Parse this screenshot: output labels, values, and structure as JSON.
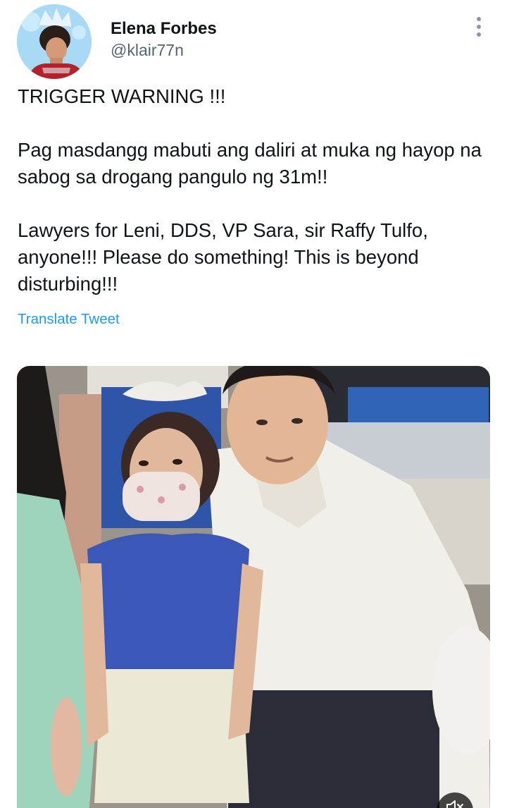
{
  "author": {
    "display_name": "Elena Forbes",
    "handle": "@klair77n",
    "avatar_icon": "avatar-illustration"
  },
  "tweet": {
    "paragraphs": [
      "TRIGGER WARNING !!!",
      "Pag masdangg mabuti ang daliri at muka ng hayop na sabog sa drogang pangulo ng 31m!!",
      "Lawyers for Leni, DDS, VP Sara, sir Raffy Tulfo, anyone!!! Please do something! This is beyond disturbing!!!"
    ],
    "translate_label": "Translate Tweet"
  },
  "icons": {
    "more": "more-vertical-icon",
    "mute": "volume-muted-icon"
  },
  "colors": {
    "text": "#0f1419",
    "secondary": "#536471",
    "link": "#1d9bf0"
  }
}
